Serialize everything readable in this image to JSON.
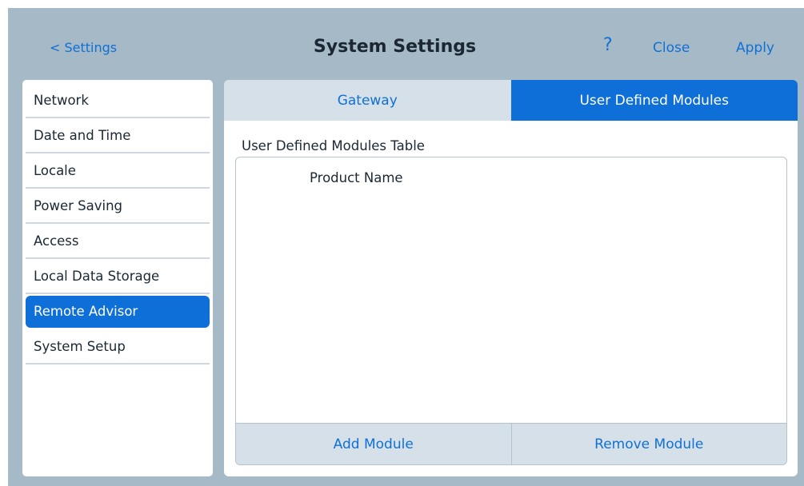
{
  "header": {
    "back_label": "< Settings",
    "title": "System Settings",
    "help_label": "?",
    "close_label": "Close",
    "apply_label": "Apply"
  },
  "sidebar": {
    "items": [
      {
        "label": "Network",
        "active": false
      },
      {
        "label": "Date and Time",
        "active": false
      },
      {
        "label": "Locale",
        "active": false
      },
      {
        "label": "Power Saving",
        "active": false
      },
      {
        "label": "Access",
        "active": false
      },
      {
        "label": "Local Data Storage",
        "active": false
      },
      {
        "label": "Remote Advisor",
        "active": true
      },
      {
        "label": "System Setup",
        "active": false
      }
    ]
  },
  "tabs": [
    {
      "label": "Gateway",
      "active": false
    },
    {
      "label": "User Defined Modules",
      "active": true
    }
  ],
  "main": {
    "section_title": "User Defined Modules Table",
    "table": {
      "columns": [
        "Product Name"
      ],
      "rows": []
    },
    "add_label": "Add Module",
    "remove_label": "Remove Module"
  },
  "colors": {
    "accent": "#0f6fd8",
    "link": "#1070d6",
    "background": "#a6b9c6",
    "tab_inactive": "#d5e0e8"
  }
}
